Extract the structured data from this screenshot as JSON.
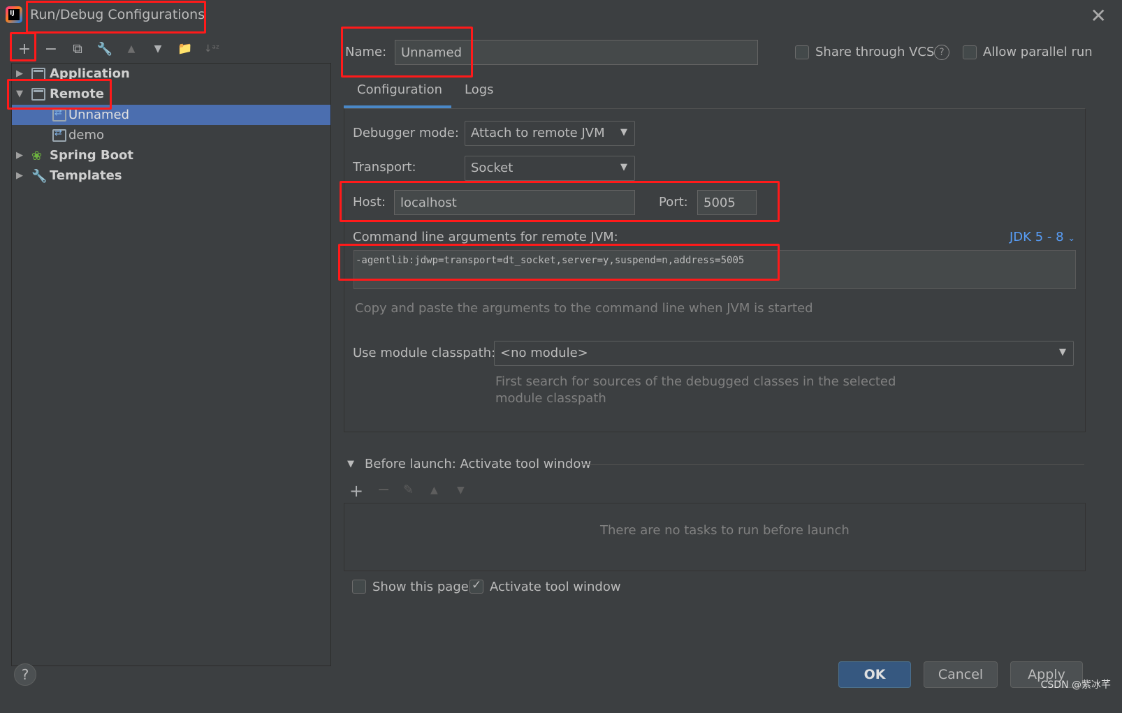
{
  "window": {
    "title": "Run/Debug Configurations",
    "close_glyph": "✕"
  },
  "toolbar": {
    "add": "+",
    "remove": "−",
    "copy": "⧉",
    "edit": "🔧",
    "up": "▲",
    "down": "▼",
    "folder": "📁",
    "sort": "↓ᵃᶻ"
  },
  "tree": {
    "application": "Application",
    "remote": "Remote",
    "unnamed": "Unnamed",
    "demo": "demo",
    "spring_boot": "Spring Boot",
    "templates": "Templates"
  },
  "header": {
    "name_label": "Name:",
    "name_value": "Unnamed",
    "share_vcs": "Share through VCS",
    "allow_parallel": "Allow parallel run",
    "share_vcs_checked": false,
    "allow_parallel_checked": false
  },
  "tabs": [
    {
      "label": "Configuration",
      "active": true
    },
    {
      "label": "Logs",
      "active": false
    }
  ],
  "config": {
    "debugger_mode_label": "Debugger mode:",
    "debugger_mode_value": "Attach to remote JVM",
    "transport_label": "Transport:",
    "transport_value": "Socket",
    "host_label": "Host:",
    "host_value": "localhost",
    "port_label": "Port:",
    "port_value": "5005",
    "cmdline_label": "Command line arguments for remote JVM:",
    "jdk_link": "JDK 5 - 8",
    "cmdline_value": "-agentlib:jdwp=transport=dt_socket,server=y,suspend=n,address=5005",
    "cmdline_hint": "Copy and paste the arguments to the command line when JVM is started",
    "module_label": "Use module classpath:",
    "module_value": "<no module>",
    "module_hint_1": "First search for sources of the debugged classes in the selected",
    "module_hint_2": "module classpath"
  },
  "before_launch": {
    "title": "Before launch: Activate tool window",
    "empty_text": "There are no tasks to run before launch",
    "show_page": "Show this page",
    "show_page_checked": false,
    "activate_window": "Activate tool window",
    "activate_window_checked": true
  },
  "buttons": {
    "ok": "OK",
    "cancel": "Cancel",
    "apply": "Apply",
    "help": "?"
  },
  "watermark": "CSDN @紫冰芊",
  "colors": {
    "accent": "#4b6eaf",
    "annotation": "#ff1a1a",
    "link": "#589df6"
  }
}
